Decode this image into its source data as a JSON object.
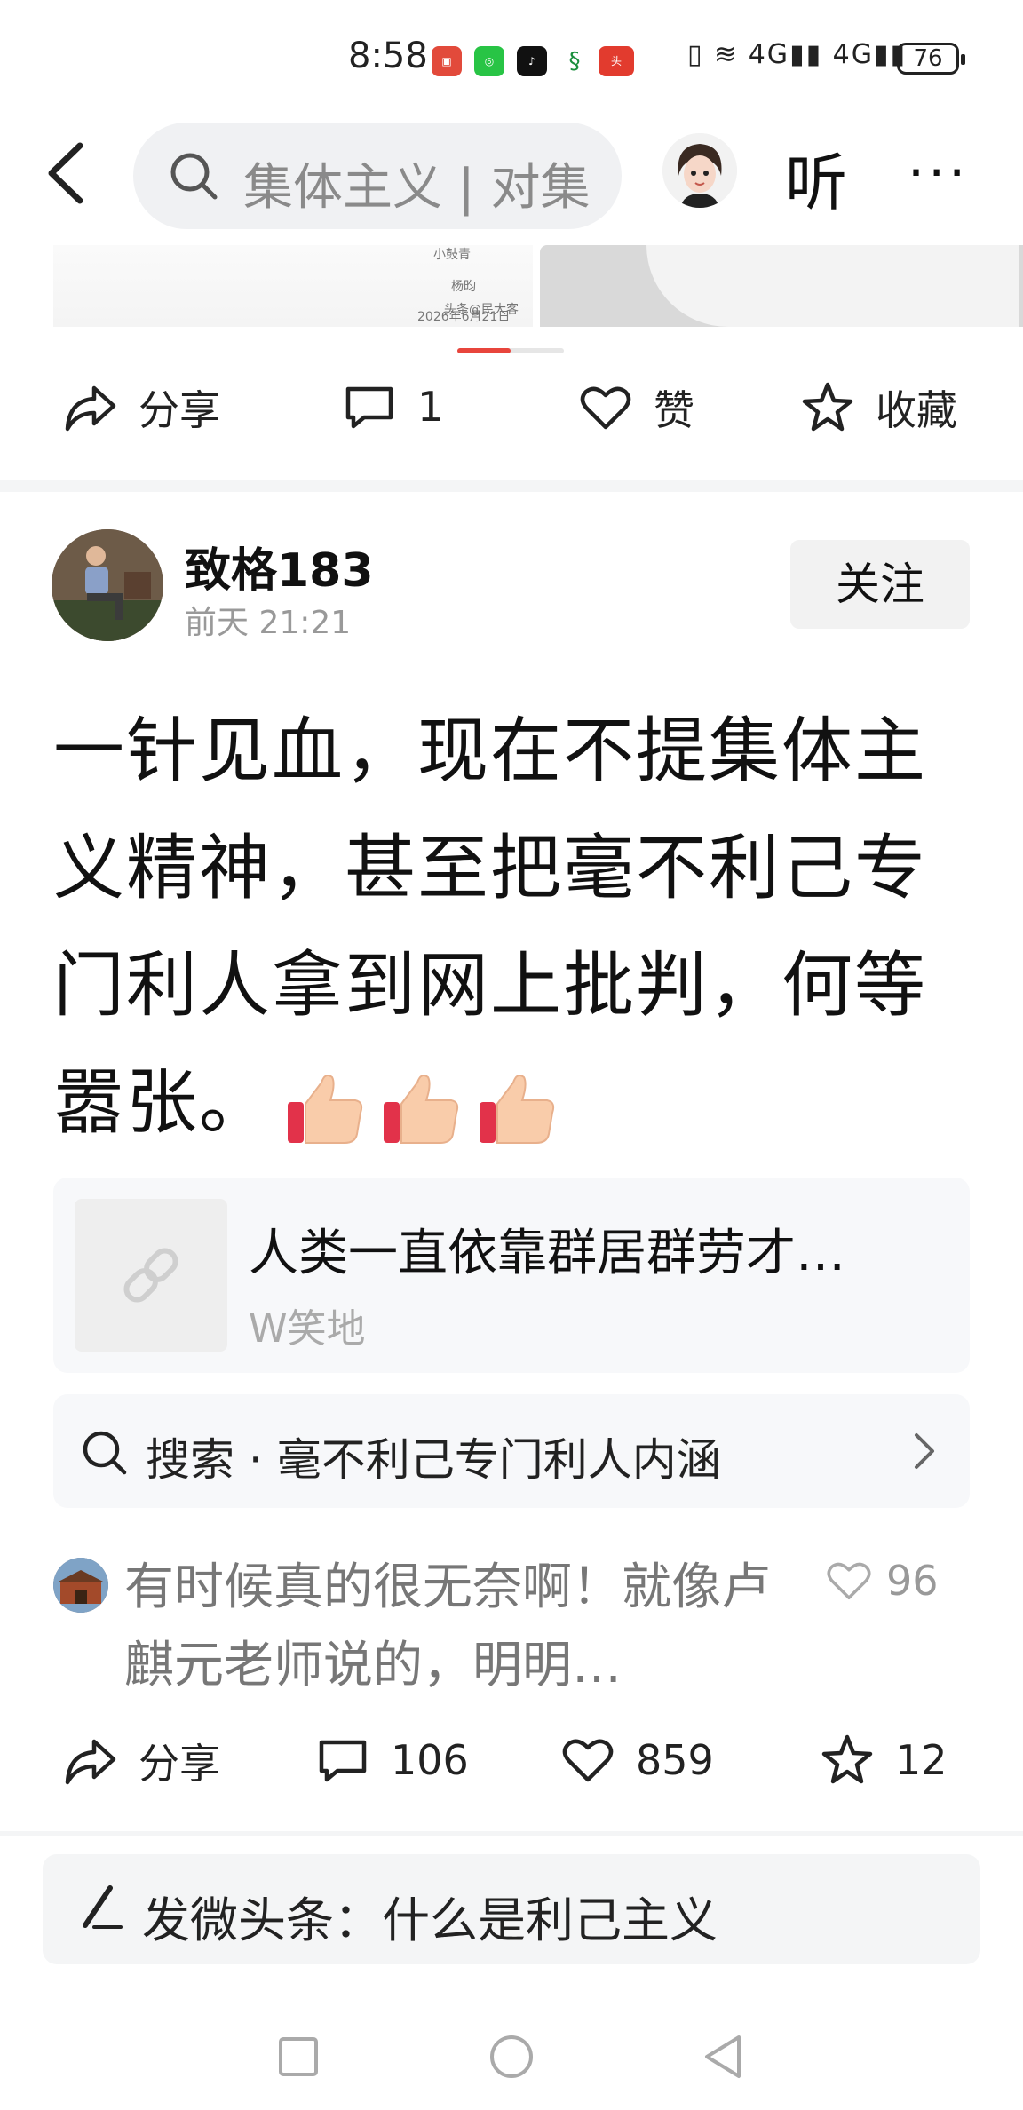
{
  "status_bar": {
    "time": "8:58",
    "network": "4G",
    "battery": "76",
    "app_badges": [
      "huawei",
      "wechat",
      "tiktok",
      "mobile-service",
      "toutiao"
    ]
  },
  "header": {
    "search_text": "集体主义 | 对集",
    "listen_label": "听",
    "more_label": "···"
  },
  "image_strip": {
    "caption_lines": [
      "小鼓青",
      "杨昀",
      "头条@民大客",
      "2026年6月21日"
    ]
  },
  "top_actions": {
    "share": "分享",
    "comments": "1",
    "like": "赞",
    "favorite": "收藏"
  },
  "post": {
    "author": "致格183",
    "time": "前天  21:21",
    "follow": "关注",
    "text": "一针见血，现在不提集体主义精神，甚至把毫不利己专门利人拿到网上批判，何等嚣张。",
    "emoji": "thumbs-up"
  },
  "link_card": {
    "title": "人类一直依靠群居群劳才…",
    "source": "W笑地"
  },
  "search_suggest": {
    "prefix": "搜索",
    "dot": "·",
    "query": "毫不利己专门利人内涵"
  },
  "top_comment": {
    "text": "有时候真的很无奈啊！就像卢麒元老师说的，明明…",
    "likes": "96"
  },
  "bottom_actions": {
    "share": "分享",
    "comments": "106",
    "likes": "859",
    "favorites": "12"
  },
  "compose": {
    "text": "发微头条：什么是利己主义"
  },
  "colors": {
    "accent": "#e8453c",
    "muted": "#999999",
    "panel": "#f7f8fa"
  }
}
